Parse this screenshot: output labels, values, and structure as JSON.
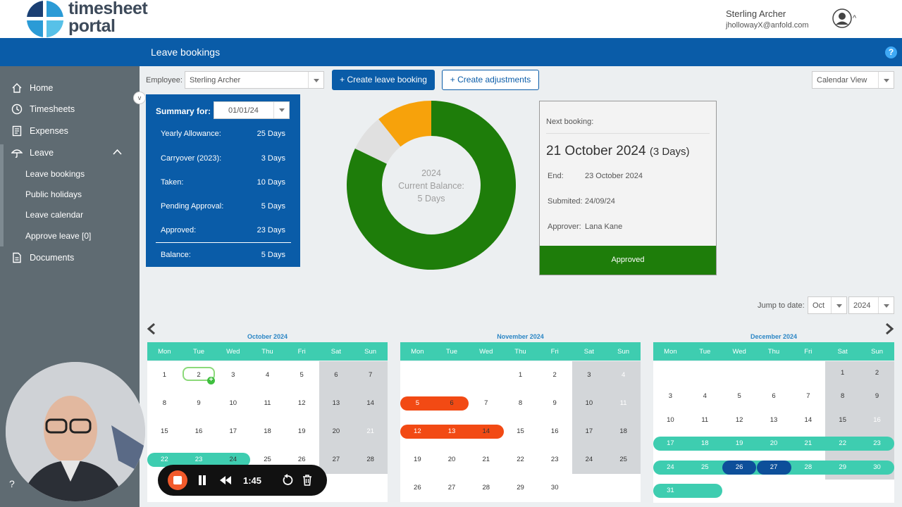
{
  "app": {
    "logo_line1": "timesheet",
    "logo_line2": "portal"
  },
  "user": {
    "name": "Sterling Archer",
    "email": "jhollowayX@anfold.com",
    "caret": "^"
  },
  "header": {
    "title": "Leave bookings",
    "help": "?"
  },
  "sidebar": {
    "collapse": "v",
    "items": [
      {
        "label": "Home",
        "icon": "home-icon"
      },
      {
        "label": "Timesheets",
        "icon": "clock-icon"
      },
      {
        "label": "Expenses",
        "icon": "receipt-icon"
      },
      {
        "label": "Leave",
        "icon": "umbrella-icon"
      },
      {
        "label": "Documents",
        "icon": "document-icon"
      }
    ],
    "leave_sub": [
      {
        "label": "Leave bookings"
      },
      {
        "label": "Public holidays"
      },
      {
        "label": "Leave calendar"
      },
      {
        "label": "Approve leave [0]"
      }
    ],
    "help": "?"
  },
  "toolbar": {
    "employee_label": "Employee:",
    "employee_value": "Sterling Archer",
    "create_booking": "+ Create leave booking",
    "create_adjust": "+ Create adjustments",
    "view_value": "Calendar View"
  },
  "summary": {
    "title": "Summary for:",
    "date": "01/01/24",
    "rows": [
      {
        "label": "Yearly Allowance:",
        "value": "25 Days"
      },
      {
        "label": "Carryover (2023):",
        "value": "3 Days"
      },
      {
        "label": "Taken:",
        "value": "10 Days"
      },
      {
        "label": "Pending Approval:",
        "value": "5 Days"
      },
      {
        "label": "Approved:",
        "value": "23 Days"
      },
      {
        "label": "Balance:",
        "value": "5 Days"
      }
    ]
  },
  "balance": {
    "year": "2024",
    "label": "Current Balance:",
    "value": "5 Days",
    "segments": [
      {
        "name": "Approved",
        "days": 23,
        "color": "#1e7d0a"
      },
      {
        "name": "Balance",
        "days": 2,
        "color": "#e0e0e0"
      },
      {
        "name": "Pending",
        "days": 3,
        "color": "#f7a20b"
      }
    ]
  },
  "next_booking": {
    "heading": "Next booking:",
    "date": "21 October 2024",
    "days": "(3 Days)",
    "end_label": "End:",
    "end": "23 October 2024",
    "submitted_label": "Submited:",
    "submitted": "24/09/24",
    "approver_label": "Approver:",
    "approver": "Lana Kane",
    "status": "Approved",
    "status_color": "#1e7d0a"
  },
  "jump": {
    "label": "Jump to date:",
    "month": "Oct",
    "year": "2024"
  },
  "calendar": {
    "weekdays": [
      "Mon",
      "Tue",
      "Wed",
      "Thu",
      "Fri",
      "Sat",
      "Sun"
    ],
    "colors": {
      "header": "#3ecdb0",
      "approved": "#3ecdb0",
      "taken": "#f24a14",
      "pending": "#0d4f9a",
      "weekend": "#d3d6d9",
      "today": "#8cd97a"
    },
    "months": [
      {
        "title": "October 2024",
        "start": 1,
        "days": 31,
        "visible_weeks": 4
      },
      {
        "title": "November 2024",
        "start": 4,
        "days": 30,
        "visible_weeks": 5
      },
      {
        "title": "December 2024",
        "start": 6,
        "days": 31,
        "visible_weeks": 6
      }
    ]
  },
  "recorder": {
    "time": "1:45"
  }
}
